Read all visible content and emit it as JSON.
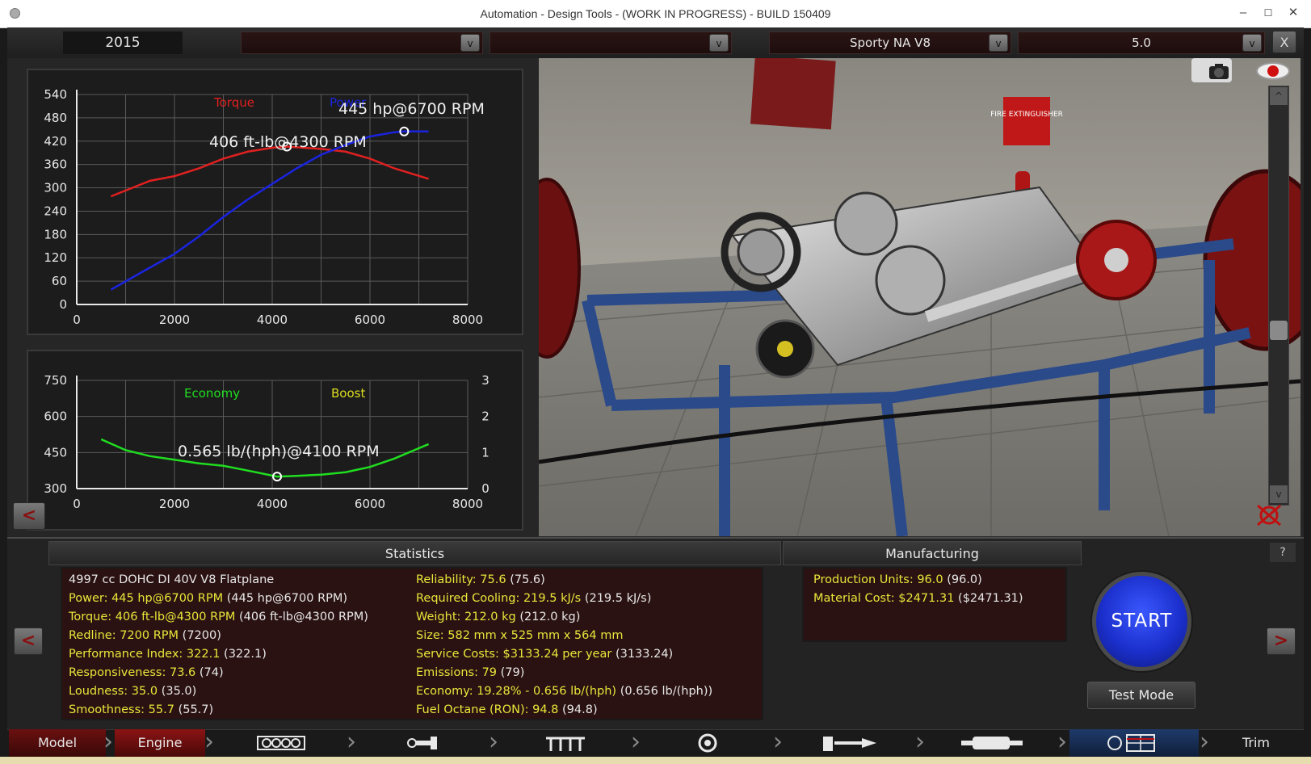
{
  "window": {
    "title": "Automation - Design Tools - (WORK IN PROGRESS) - BUILD 150409",
    "minimize": "–",
    "maximize": "☐",
    "close": "✕"
  },
  "topbar": {
    "year": "2015",
    "dropdown1": "",
    "dropdown2": "",
    "engine_family": "Sporty NA V8",
    "displacement": "5.0",
    "arrow": "v",
    "close": "X"
  },
  "power_chart": {
    "legend_torque": "Torque",
    "legend_power": "Power",
    "torque_color": "#e02020",
    "power_color": "#1a24e0",
    "peak_power_label": "445 hp@6700 RPM",
    "peak_torque_label": "406 ft-lb@4300 RPM",
    "x_ticks": [
      "0",
      "2000",
      "4000",
      "6000",
      "8000"
    ],
    "y_ticks": [
      "540",
      "480",
      "420",
      "360",
      "300",
      "240",
      "180",
      "120",
      "60",
      "0"
    ]
  },
  "economy_chart": {
    "legend_economy": "Economy",
    "legend_boost": "Boost",
    "economy_color": "#20dd20",
    "boost_color": "#dddd20",
    "best_label": "0.565 lb/(hph)@4100 RPM",
    "x_ticks": [
      "0",
      "2000",
      "4000",
      "6000",
      "8000"
    ],
    "y_left_ticks": [
      "750",
      "600",
      "450",
      "300"
    ],
    "y_right_ticks": [
      "3",
      "2",
      "1",
      "0"
    ]
  },
  "chart_data": [
    {
      "type": "line",
      "title": "",
      "xlabel": "",
      "ylabel": "",
      "xlim": [
        0,
        8000
      ],
      "ylim": [
        0,
        540
      ],
      "grid": true,
      "legend": "top",
      "series": [
        {
          "name": "Torque",
          "x": [
            700,
            1500,
            2000,
            2500,
            3000,
            3500,
            4000,
            4300,
            5000,
            5500,
            6000,
            6500,
            7200
          ],
          "values": [
            278,
            318,
            330,
            350,
            375,
            393,
            403,
            406,
            400,
            393,
            375,
            350,
            323
          ]
        },
        {
          "name": "Power",
          "x": [
            700,
            1500,
            2000,
            2500,
            3000,
            3500,
            4000,
            4500,
            5000,
            5500,
            6000,
            6500,
            6700,
            7200
          ],
          "values": [
            38,
            95,
            130,
            175,
            225,
            270,
            310,
            350,
            385,
            410,
            432,
            443,
            445,
            445
          ]
        }
      ]
    },
    {
      "type": "line",
      "title": "",
      "xlabel": "",
      "ylabel": "",
      "xlim": [
        0,
        8000
      ],
      "ylim": [
        300,
        750
      ],
      "grid": true,
      "legend": "top",
      "series": [
        {
          "name": "Economy",
          "x": [
            500,
            1000,
            1500,
            2000,
            2500,
            3000,
            3500,
            4100,
            4500,
            5000,
            5500,
            6000,
            6500,
            7200
          ],
          "values": [
            505,
            460,
            435,
            420,
            405,
            395,
            375,
            350,
            353,
            358,
            368,
            390,
            425,
            485
          ]
        }
      ]
    }
  ],
  "statistics": {
    "heading": "Statistics",
    "left": [
      {
        "label": "4997 cc DOHC DI 40V V8 Flatplane",
        "paren": ""
      },
      {
        "label": "Power: 445 hp@6700 RPM",
        "paren": "(445 hp@6700 RPM)"
      },
      {
        "label": "Torque: 406 ft-lb@4300 RPM",
        "paren": "(406 ft-lb@4300 RPM)"
      },
      {
        "label": "Redline: 7200 RPM",
        "paren": "(7200)"
      },
      {
        "label": "Performance Index: 322.1",
        "paren": "(322.1)"
      },
      {
        "label": "Responsiveness: 73.6",
        "paren": "(74)"
      },
      {
        "label": "Loudness: 35.0",
        "paren": "(35.0)"
      },
      {
        "label": "Smoothness: 55.7",
        "paren": "(55.7)"
      }
    ],
    "right": [
      {
        "label": "Reliability: 75.6",
        "paren": "(75.6)"
      },
      {
        "label": "Required Cooling: 219.5 kJ/s",
        "paren": "(219.5 kJ/s)"
      },
      {
        "label": "Weight: 212.0 kg",
        "paren": "(212.0 kg)"
      },
      {
        "label": "Size: 582 mm x 525 mm x 564 mm",
        "paren": ""
      },
      {
        "label": "Service Costs: $3133.24 per year",
        "paren": "(3133.24)"
      },
      {
        "label": "Emissions: 79",
        "paren": "(79)"
      },
      {
        "label": "Economy: 19.28% - 0.656 lb/(hph)",
        "paren": "(0.656 lb/(hph))"
      },
      {
        "label": "Fuel Octane (RON): 94.8",
        "paren": "(94.8)"
      }
    ]
  },
  "manufacturing": {
    "heading": "Manufacturing",
    "rows": [
      {
        "label": "Production Units: 96.0",
        "paren": "(96.0)"
      },
      {
        "label": "Material Cost: $2471.31",
        "paren": "($2471.31)"
      }
    ]
  },
  "controls": {
    "start": "START",
    "test_mode": "Test Mode",
    "help": "?",
    "prev": "<",
    "next": ">",
    "scroll_up": "^",
    "scroll_down": "v"
  },
  "tabs": {
    "model": "Model",
    "engine": "Engine",
    "trim": "Trim",
    "icons": [
      "engine-block-icon",
      "crankshaft-icon",
      "valvetrain-icon",
      "turbo-icon",
      "fuel-icon",
      "exhaust-icon",
      "tuning-icon"
    ]
  },
  "scene_signs": {
    "fire": "FIRE EXTINGUISHER"
  }
}
